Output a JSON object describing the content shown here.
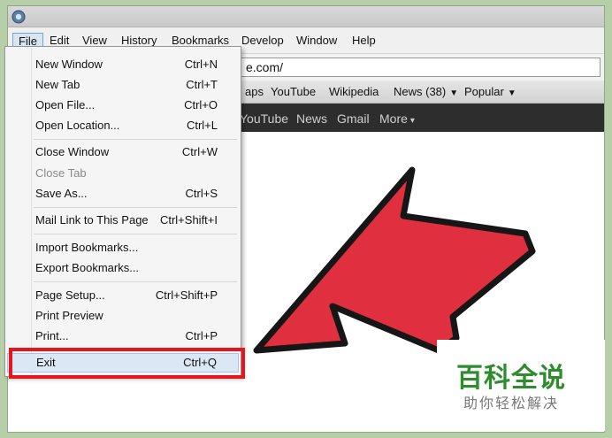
{
  "menubar": {
    "items": [
      "File",
      "Edit",
      "View",
      "History",
      "Bookmarks",
      "Develop",
      "Window",
      "Help"
    ]
  },
  "address": {
    "url_visible": "e.com/"
  },
  "bookmarks": {
    "items": [
      "aps",
      "YouTube",
      "Wikipedia",
      "News (38)",
      "Popular"
    ]
  },
  "google_bar": {
    "items": [
      "YouTube",
      "News",
      "Gmail",
      "More"
    ]
  },
  "file_menu": {
    "items": [
      {
        "label": "New Window",
        "shortcut": "Ctrl+N"
      },
      {
        "label": "New Tab",
        "shortcut": "Ctrl+T"
      },
      {
        "label": "Open File...",
        "shortcut": "Ctrl+O"
      },
      {
        "label": "Open Location...",
        "shortcut": "Ctrl+L"
      },
      {
        "label": "Close Window",
        "shortcut": "Ctrl+W"
      },
      {
        "label": "Close Tab",
        "shortcut": ""
      },
      {
        "label": "Save As...",
        "shortcut": "Ctrl+S"
      },
      {
        "label": "Mail Link to This Page",
        "shortcut": "Ctrl+Shift+I"
      },
      {
        "label": "Import Bookmarks...",
        "shortcut": ""
      },
      {
        "label": "Export Bookmarks...",
        "shortcut": ""
      },
      {
        "label": "Page Setup...",
        "shortcut": "Ctrl+Shift+P"
      },
      {
        "label": "Print Preview",
        "shortcut": ""
      },
      {
        "label": "Print...",
        "shortcut": "Ctrl+P"
      },
      {
        "label": "Exit",
        "shortcut": "Ctrl+Q"
      }
    ]
  },
  "watermark": {
    "title": "百科全说",
    "subtitle": "助你轻松解决"
  },
  "colors": {
    "highlight_box": "#e4151f",
    "arrow_fill": "#e0303f",
    "watermark_green": "#2e8c2e"
  }
}
